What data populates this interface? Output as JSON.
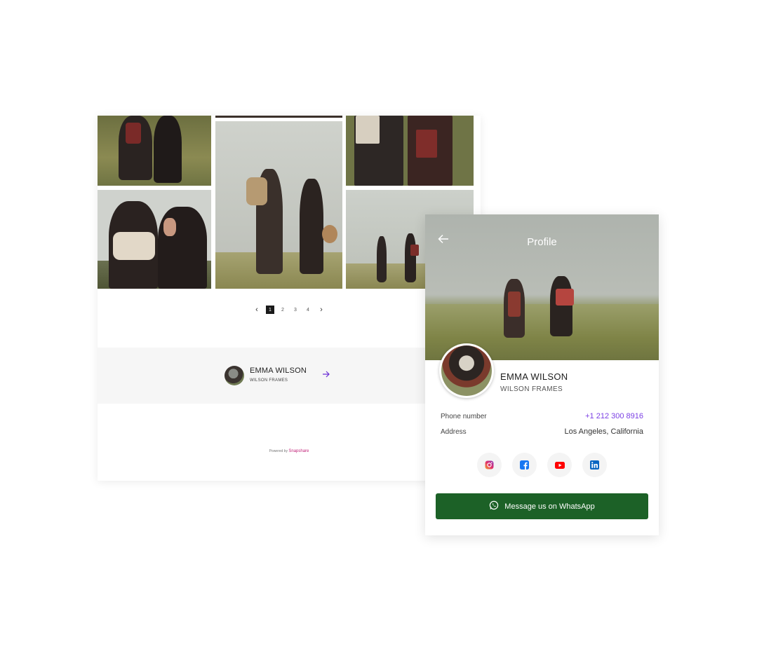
{
  "gallery": {
    "pagination": {
      "prev_icon": "chevron-left-icon",
      "next_icon": "chevron-right-icon",
      "pages": [
        "1",
        "2",
        "3",
        "4"
      ],
      "current_page": "1"
    },
    "author": {
      "name": "EMMA WILSON",
      "company": "WILSON FRAMES",
      "arrow_icon": "arrow-right-icon",
      "arrow_color": "#6b2fd6"
    },
    "powered_by": {
      "prefix": "Powered by",
      "brand": "Snapshare",
      "brand_color": "#c2257a"
    }
  },
  "profile": {
    "title": "Profile",
    "back_icon": "arrow-left-icon",
    "name": "EMMA WILSON",
    "company": "WILSON FRAMES",
    "details": [
      {
        "label": "Phone number",
        "value": "+1 212 300 8916",
        "is_link": true
      },
      {
        "label": "Address",
        "value": "Los Angeles, California",
        "is_link": false
      }
    ],
    "socials": [
      {
        "name": "instagram-icon"
      },
      {
        "name": "facebook-icon"
      },
      {
        "name": "youtube-icon"
      },
      {
        "name": "linkedin-icon"
      }
    ],
    "whatsapp_button": {
      "label": "Message us on WhatsApp",
      "icon": "whatsapp-icon",
      "color": "#1c6127"
    },
    "link_color": "#7b3fe4"
  }
}
